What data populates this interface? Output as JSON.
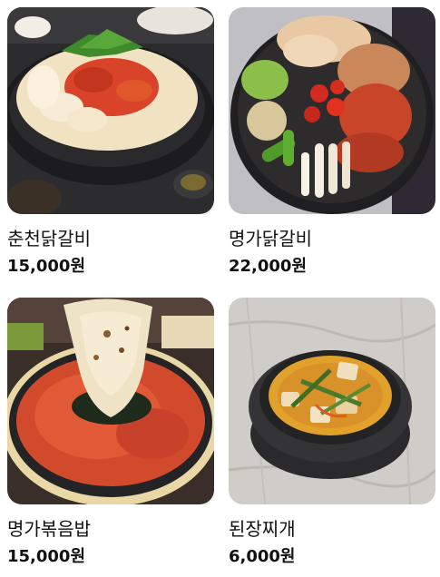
{
  "menu": {
    "items": [
      {
        "name": "춘천닭갈비",
        "price": "15,000원",
        "image": "spicy-chicken-rice-cake-pan"
      },
      {
        "name": "명가닭갈비",
        "price": "22,000원",
        "image": "grilled-chicken-vegetable-pan"
      },
      {
        "name": "명가볶음밥",
        "price": "15,000원",
        "image": "fried-rice-pan-with-seaweed"
      },
      {
        "name": "된장찌개",
        "price": "6,000원",
        "image": "soybean-paste-stew-pot"
      }
    ]
  },
  "colors": {
    "text": "#111111",
    "card_radius_bg": "#ffffff"
  }
}
